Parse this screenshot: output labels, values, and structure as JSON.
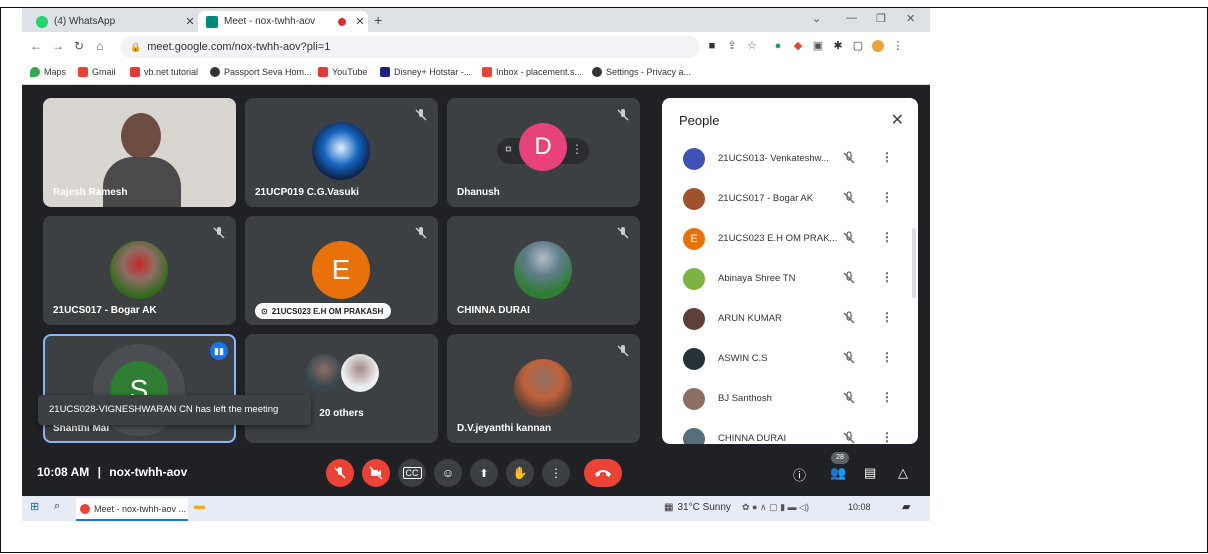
{
  "browser": {
    "tabs": [
      {
        "label": "(4) WhatsApp",
        "color": "#25d366"
      },
      {
        "label": "Meet - nox-twhh-aov",
        "color": "#00897b"
      }
    ],
    "url": "meet.google.com/nox-twhh-aov?pli=1",
    "bookmarks": [
      "Maps",
      "Gmail",
      "vb.net tutorial",
      "Passport Seva Hom...",
      "YouTube",
      "Disney+ Hotstar -...",
      "Inbox - placement.s...",
      "Settings - Privacy a..."
    ]
  },
  "meeting": {
    "tiles": [
      {
        "name": "Rajesh Ramesh",
        "muted": false,
        "kind": "video"
      },
      {
        "name": "21UCP019 C.G.Vasuki",
        "muted": true,
        "kind": "photo"
      },
      {
        "name": "Dhanush",
        "muted": true,
        "kind": "letter",
        "letter": "D",
        "color": "#e8427a"
      },
      {
        "name": "21UCS017 - Bogar AK",
        "muted": true,
        "kind": "photo"
      },
      {
        "name": "21UCS023 E.H OM PRAKASH",
        "muted": true,
        "kind": "letter",
        "letter": "E",
        "color": "#e8710a"
      },
      {
        "name": "CHINNA DURAI",
        "muted": true,
        "kind": "photo"
      },
      {
        "name": "Shanthi Mai",
        "muted": false,
        "speaking": true,
        "kind": "letter",
        "letter": "S",
        "color": "#2e7d32"
      },
      {
        "name": "20 others",
        "muted": false,
        "kind": "group"
      },
      {
        "name": "D.V.jeyanthi kannan",
        "muted": true,
        "kind": "photo"
      }
    ],
    "toast": "21UCS028-VIGNESHWARAN CN has left the meeting",
    "time": "10:08 AM",
    "separator": "|",
    "code": "nox-twhh-aov",
    "participant_count": "28"
  },
  "people": {
    "title": "People",
    "list": [
      {
        "name": "21UCS013- Venkateshw...",
        "color": "#3f51b5"
      },
      {
        "name": "21UCS017 - Bogar AK",
        "color": "#a0522d"
      },
      {
        "name": "21UCS023 E.H OM PRAK...",
        "color": "#e8710a",
        "letter": "E"
      },
      {
        "name": "Abinaya Shree TN",
        "color": "#7cb342"
      },
      {
        "name": "ARUN KUMAR",
        "color": "#5d4037"
      },
      {
        "name": "ASWIN C.S",
        "color": "#263238"
      },
      {
        "name": "BJ Santhosh",
        "color": "#8d6e63"
      },
      {
        "name": "CHINNA DURAI",
        "color": "#546e7a"
      }
    ]
  },
  "taskbar": {
    "app": "Meet - nox-twhh-aov ...",
    "weather": "31°C  Sunny",
    "clock": "10:08"
  }
}
